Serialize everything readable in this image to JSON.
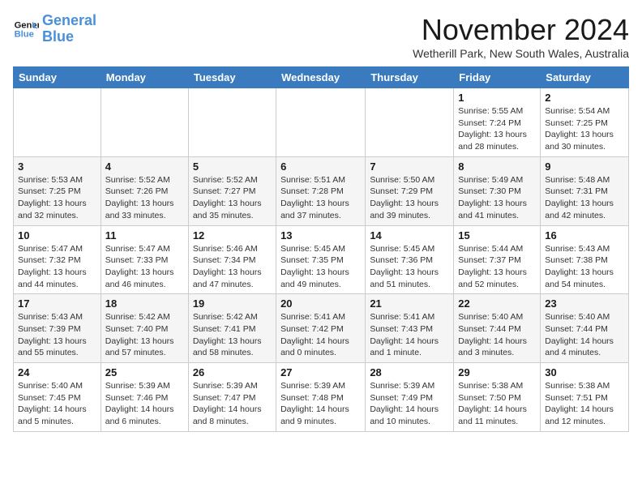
{
  "logo": {
    "line1": "General",
    "line2": "Blue"
  },
  "title": "November 2024",
  "subtitle": "Wetherill Park, New South Wales, Australia",
  "weekdays": [
    "Sunday",
    "Monday",
    "Tuesday",
    "Wednesday",
    "Thursday",
    "Friday",
    "Saturday"
  ],
  "weeks": [
    [
      {
        "day": "",
        "info": ""
      },
      {
        "day": "",
        "info": ""
      },
      {
        "day": "",
        "info": ""
      },
      {
        "day": "",
        "info": ""
      },
      {
        "day": "",
        "info": ""
      },
      {
        "day": "1",
        "info": "Sunrise: 5:55 AM\nSunset: 7:24 PM\nDaylight: 13 hours\nand 28 minutes."
      },
      {
        "day": "2",
        "info": "Sunrise: 5:54 AM\nSunset: 7:25 PM\nDaylight: 13 hours\nand 30 minutes."
      }
    ],
    [
      {
        "day": "3",
        "info": "Sunrise: 5:53 AM\nSunset: 7:25 PM\nDaylight: 13 hours\nand 32 minutes."
      },
      {
        "day": "4",
        "info": "Sunrise: 5:52 AM\nSunset: 7:26 PM\nDaylight: 13 hours\nand 33 minutes."
      },
      {
        "day": "5",
        "info": "Sunrise: 5:52 AM\nSunset: 7:27 PM\nDaylight: 13 hours\nand 35 minutes."
      },
      {
        "day": "6",
        "info": "Sunrise: 5:51 AM\nSunset: 7:28 PM\nDaylight: 13 hours\nand 37 minutes."
      },
      {
        "day": "7",
        "info": "Sunrise: 5:50 AM\nSunset: 7:29 PM\nDaylight: 13 hours\nand 39 minutes."
      },
      {
        "day": "8",
        "info": "Sunrise: 5:49 AM\nSunset: 7:30 PM\nDaylight: 13 hours\nand 41 minutes."
      },
      {
        "day": "9",
        "info": "Sunrise: 5:48 AM\nSunset: 7:31 PM\nDaylight: 13 hours\nand 42 minutes."
      }
    ],
    [
      {
        "day": "10",
        "info": "Sunrise: 5:47 AM\nSunset: 7:32 PM\nDaylight: 13 hours\nand 44 minutes."
      },
      {
        "day": "11",
        "info": "Sunrise: 5:47 AM\nSunset: 7:33 PM\nDaylight: 13 hours\nand 46 minutes."
      },
      {
        "day": "12",
        "info": "Sunrise: 5:46 AM\nSunset: 7:34 PM\nDaylight: 13 hours\nand 47 minutes."
      },
      {
        "day": "13",
        "info": "Sunrise: 5:45 AM\nSunset: 7:35 PM\nDaylight: 13 hours\nand 49 minutes."
      },
      {
        "day": "14",
        "info": "Sunrise: 5:45 AM\nSunset: 7:36 PM\nDaylight: 13 hours\nand 51 minutes."
      },
      {
        "day": "15",
        "info": "Sunrise: 5:44 AM\nSunset: 7:37 PM\nDaylight: 13 hours\nand 52 minutes."
      },
      {
        "day": "16",
        "info": "Sunrise: 5:43 AM\nSunset: 7:38 PM\nDaylight: 13 hours\nand 54 minutes."
      }
    ],
    [
      {
        "day": "17",
        "info": "Sunrise: 5:43 AM\nSunset: 7:39 PM\nDaylight: 13 hours\nand 55 minutes."
      },
      {
        "day": "18",
        "info": "Sunrise: 5:42 AM\nSunset: 7:40 PM\nDaylight: 13 hours\nand 57 minutes."
      },
      {
        "day": "19",
        "info": "Sunrise: 5:42 AM\nSunset: 7:41 PM\nDaylight: 13 hours\nand 58 minutes."
      },
      {
        "day": "20",
        "info": "Sunrise: 5:41 AM\nSunset: 7:42 PM\nDaylight: 14 hours\nand 0 minutes."
      },
      {
        "day": "21",
        "info": "Sunrise: 5:41 AM\nSunset: 7:43 PM\nDaylight: 14 hours\nand 1 minute."
      },
      {
        "day": "22",
        "info": "Sunrise: 5:40 AM\nSunset: 7:44 PM\nDaylight: 14 hours\nand 3 minutes."
      },
      {
        "day": "23",
        "info": "Sunrise: 5:40 AM\nSunset: 7:44 PM\nDaylight: 14 hours\nand 4 minutes."
      }
    ],
    [
      {
        "day": "24",
        "info": "Sunrise: 5:40 AM\nSunset: 7:45 PM\nDaylight: 14 hours\nand 5 minutes."
      },
      {
        "day": "25",
        "info": "Sunrise: 5:39 AM\nSunset: 7:46 PM\nDaylight: 14 hours\nand 6 minutes."
      },
      {
        "day": "26",
        "info": "Sunrise: 5:39 AM\nSunset: 7:47 PM\nDaylight: 14 hours\nand 8 minutes."
      },
      {
        "day": "27",
        "info": "Sunrise: 5:39 AM\nSunset: 7:48 PM\nDaylight: 14 hours\nand 9 minutes."
      },
      {
        "day": "28",
        "info": "Sunrise: 5:39 AM\nSunset: 7:49 PM\nDaylight: 14 hours\nand 10 minutes."
      },
      {
        "day": "29",
        "info": "Sunrise: 5:38 AM\nSunset: 7:50 PM\nDaylight: 14 hours\nand 11 minutes."
      },
      {
        "day": "30",
        "info": "Sunrise: 5:38 AM\nSunset: 7:51 PM\nDaylight: 14 hours\nand 12 minutes."
      }
    ]
  ]
}
